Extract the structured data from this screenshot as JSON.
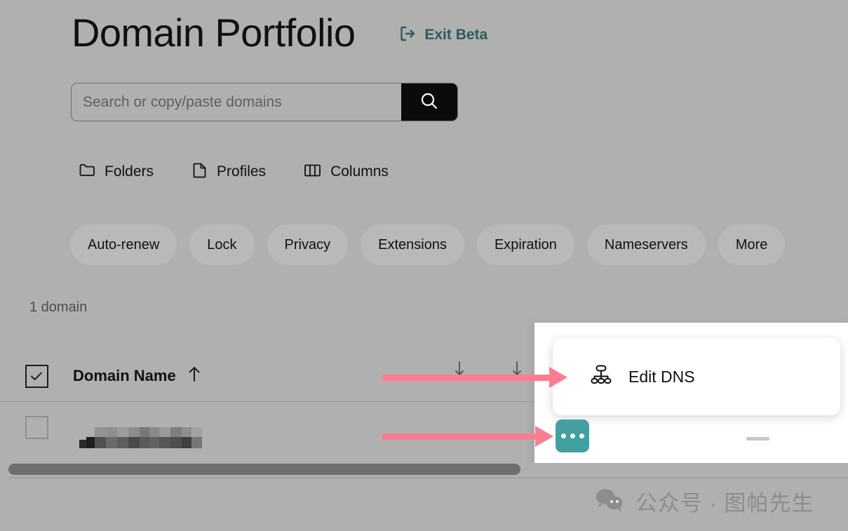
{
  "header": {
    "title": "Domain Portfolio",
    "exit_beta_label": "Exit Beta",
    "exit_icon": "exit-arrow-icon",
    "exit_color": "#2b5c5c"
  },
  "search": {
    "placeholder": "Search or copy/paste domains",
    "value": "",
    "button_icon": "search-icon",
    "button_color": "#0b0b0b"
  },
  "tools": [
    {
      "label": "Folders",
      "icon": "folder-icon"
    },
    {
      "label": "Profiles",
      "icon": "document-icon"
    },
    {
      "label": "Columns",
      "icon": "columns-icon"
    }
  ],
  "filters": [
    {
      "label": "Auto-renew"
    },
    {
      "label": "Lock"
    },
    {
      "label": "Privacy"
    },
    {
      "label": "Extensions"
    },
    {
      "label": "Expiration"
    },
    {
      "label": "Nameservers"
    },
    {
      "label": "More"
    }
  ],
  "table": {
    "count_label": "1 domain",
    "header": {
      "checkbox_checked": true,
      "domain_column_label": "Domain Name",
      "sort_icon": "arrow-up-icon",
      "extra_column_icons": [
        "arrow-down-icon",
        "arrow-down-icon"
      ]
    },
    "rows": [
      {
        "checkbox_checked": false,
        "domain_name": "",
        "domain_redacted": true,
        "value_placeholder": "—"
      }
    ]
  },
  "context_menu": {
    "items": [
      {
        "label": "Edit DNS",
        "icon": "sitemap-icon"
      }
    ]
  },
  "row_actions": {
    "more_button_icon": "ellipsis-icon",
    "more_button_color": "#43a0a0"
  },
  "annotations": {
    "arrow_color": "#fc7d91",
    "arrows": [
      {
        "name": "arrow-to-edit-dns"
      },
      {
        "name": "arrow-to-more-button"
      }
    ]
  },
  "scrollbar": {
    "orientation": "horizontal",
    "thumb_color": "#6e6e6e"
  },
  "watermark": {
    "icon": "wechat-icon",
    "text": "公众号 · 图帕先生",
    "color": "#8d8d8d"
  }
}
